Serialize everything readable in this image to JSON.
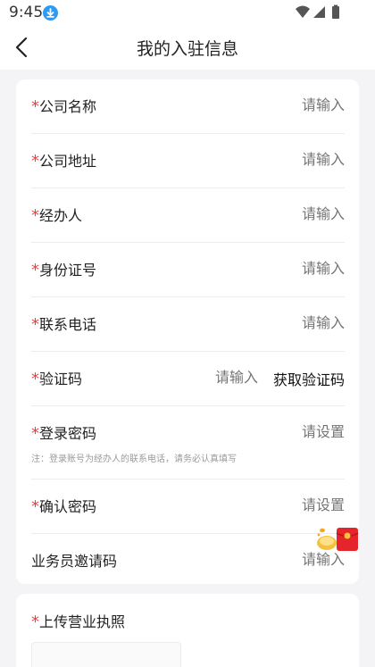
{
  "status_bar": {
    "time": "9:45",
    "download_icon": "download-icon",
    "wifi_icon": "wifi-icon",
    "signal_icon": "signal-icon",
    "battery_icon": "battery-icon"
  },
  "header": {
    "title": "我的入驻信息",
    "back_icon": "back-arrow-icon"
  },
  "colors": {
    "required_star": "#f23c3c",
    "placeholder": "#999999",
    "background": "#f4f4f6",
    "download_badge": "#2e9bf2"
  },
  "form": {
    "required_mark": "*",
    "rows": [
      {
        "label": "公司名称",
        "placeholder": "请输入",
        "required": true
      },
      {
        "label": "公司地址",
        "placeholder": "请输入",
        "required": true
      },
      {
        "label": "经办人",
        "placeholder": "请输入",
        "required": true
      },
      {
        "label": "身份证号",
        "placeholder": "请输入",
        "required": true
      },
      {
        "label": "联系电话",
        "placeholder": "请输入",
        "required": true
      },
      {
        "label": "验证码",
        "placeholder": "请输入",
        "required": true,
        "action": "获取验证码"
      },
      {
        "label": "登录密码",
        "placeholder": "请设置",
        "required": true,
        "hint": "注：登录账号为经办人的联系电话，请务必认真填写"
      },
      {
        "label": "确认密码",
        "placeholder": "请设置",
        "required": true
      },
      {
        "label": "业务员邀请码",
        "placeholder": "请输入",
        "required": false
      }
    ]
  },
  "upload": {
    "required_mark": "*",
    "label": "上传营业执照"
  }
}
